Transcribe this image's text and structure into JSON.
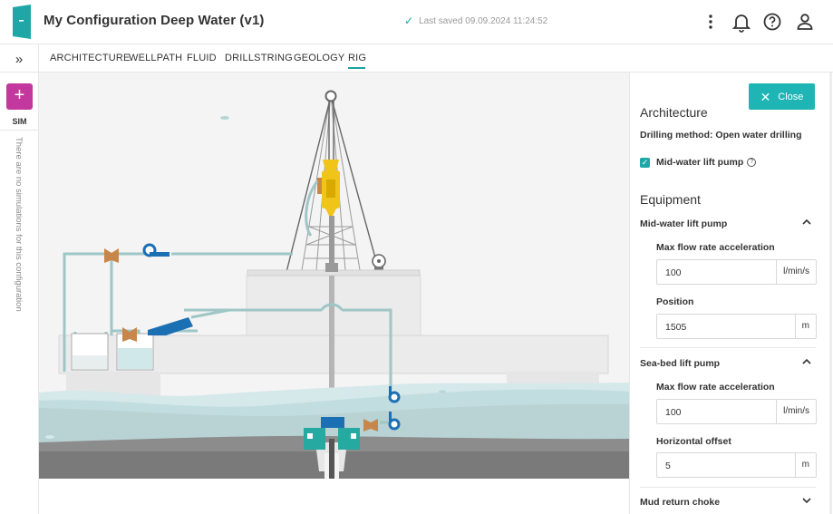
{
  "header": {
    "title": "My Configuration Deep Water (v1)",
    "saved_text": "Last saved 09.09.2024 11:24:52",
    "icons": [
      "door-exit-icon",
      "more-vert-icon",
      "bell-icon",
      "help-icon",
      "user-icon"
    ]
  },
  "rail": {
    "expand_glyph": "»",
    "add_glyph": "+",
    "sim_label": "SIM",
    "empty_text": "There are no simulations for this configuration"
  },
  "tabs": [
    {
      "label": "ARCHITECTURE",
      "active": false
    },
    {
      "label": "WELLPATH",
      "active": false
    },
    {
      "label": "FLUID",
      "active": false
    },
    {
      "label": "DRILLSTRING",
      "active": false
    },
    {
      "label": "GEOLOGY",
      "active": false
    },
    {
      "label": "RIG",
      "active": true
    }
  ],
  "colors": {
    "accent": "#1fb5b5",
    "add_button": "#c2389e",
    "pump_blue": "#1b6fb3",
    "valve_orange": "#c8874a",
    "bop_teal": "#26a9a0",
    "sea": "#bcd6d9",
    "seabed": "#8a8a8a"
  },
  "panel": {
    "close_label": "Close",
    "architecture_title": "Architecture",
    "drilling_method": "Drilling method: Open water drilling",
    "midwater_checkbox_label": "Mid-water lift pump",
    "midwater_checked": true,
    "equipment_title": "Equipment",
    "groups": [
      {
        "title": "Mid-water lift pump",
        "expanded": true,
        "fields": [
          {
            "label": "Max flow rate acceleration",
            "value": "100",
            "unit": "l/min/s"
          },
          {
            "label": "Position",
            "value": "1505",
            "unit": "m"
          }
        ]
      },
      {
        "title": "Sea-bed lift pump",
        "expanded": true,
        "fields": [
          {
            "label": "Max flow rate acceleration",
            "value": "100",
            "unit": "l/min/s"
          },
          {
            "label": "Horizontal offset",
            "value": "5",
            "unit": "m"
          }
        ]
      },
      {
        "title": "Mud return choke",
        "expanded": false,
        "fields": []
      }
    ]
  }
}
